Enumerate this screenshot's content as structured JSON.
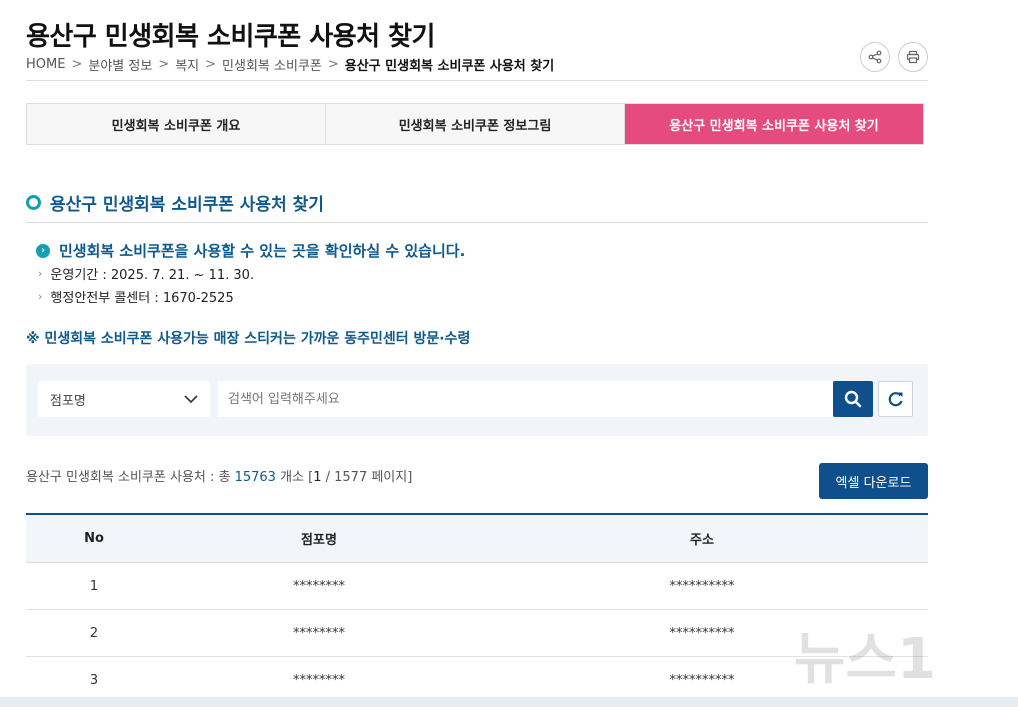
{
  "header": {
    "title": "용산구 민생회복 소비쿠폰 사용처 찾기",
    "breadcrumb": [
      "HOME",
      "분야별 정보",
      "복지",
      "민생회복 소비쿠폰",
      "용산구 민생회복 소비쿠폰 사용처 찾기"
    ],
    "share_icon": "share-icon",
    "print_icon": "print-icon"
  },
  "tabs": [
    {
      "label": "민생회복 소비쿠폰 개요",
      "active": false
    },
    {
      "label": "민생회복 소비쿠폰 정보그림",
      "active": false
    },
    {
      "label": "용산구 민생회복 소비쿠폰 사용처 찾기",
      "active": true
    }
  ],
  "section": {
    "title": "용산구 민생회복 소비쿠폰 사용처 찾기",
    "info_main": "민생회복 소비쿠폰을 사용할 수 있는 곳을 확인하실 수 있습니다.",
    "info_period": "운영기간 : 2025. 7. 21. ~ 11. 30.",
    "info_call": "행정안전부 콜센터 : 1670-2525",
    "notice": "※ 민생회복 소비쿠폰 사용가능 매장 스티커는 가까운 동주민센터 방문·수령"
  },
  "search": {
    "select_value": "점포명",
    "placeholder": "검색어 입력해주세요",
    "value": ""
  },
  "results": {
    "prefix": "용산구 민생회복 소비쿠폰 사용처 : 총 ",
    "total": "15763",
    "unit": " 개소 [",
    "current_page": "1",
    "page_sep": " / 1577 페이지]",
    "excel_label": "엑셀 다운로드"
  },
  "table": {
    "headers": [
      "No",
      "점포명",
      "주소"
    ],
    "rows": [
      {
        "no": "1",
        "name": "********",
        "address": "**********"
      },
      {
        "no": "2",
        "name": "********",
        "address": "**********"
      },
      {
        "no": "3",
        "name": "********",
        "address": "**********"
      }
    ]
  },
  "watermark": {
    "text": "뉴스1"
  },
  "colors": {
    "accent_pink": "#e54b7e",
    "primary_blue": "#0e4f8c",
    "teal": "#12a0b0"
  }
}
